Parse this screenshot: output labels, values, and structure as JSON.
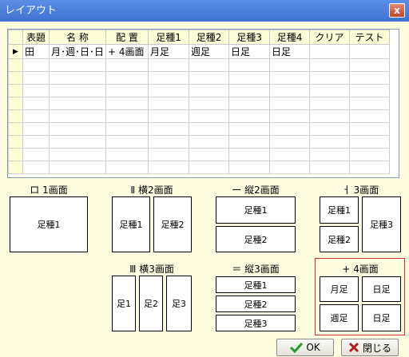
{
  "window": {
    "title": "レイアウト",
    "close_label": "x"
  },
  "grid": {
    "columns": [
      "表題",
      "名 称",
      "配 置",
      "足種1",
      "足種2",
      "足種3",
      "足種4",
      "クリア",
      "テスト"
    ],
    "rows": [
      {
        "indicator": "▶",
        "cells": [
          "田",
          "月･週･日･日",
          "+ 4画面",
          "月足",
          "週足",
          "日足",
          "日足",
          "",
          ""
        ]
      },
      {
        "indicator": "",
        "cells": [
          "",
          "",
          "",
          "",
          "",
          "",
          "",
          "",
          ""
        ]
      },
      {
        "indicator": "",
        "cells": [
          "",
          "",
          "",
          "",
          "",
          "",
          "",
          "",
          ""
        ]
      },
      {
        "indicator": "",
        "cells": [
          "",
          "",
          "",
          "",
          "",
          "",
          "",
          "",
          ""
        ]
      },
      {
        "indicator": "",
        "cells": [
          "",
          "",
          "",
          "",
          "",
          "",
          "",
          "",
          ""
        ]
      },
      {
        "indicator": "",
        "cells": [
          "",
          "",
          "",
          "",
          "",
          "",
          "",
          "",
          ""
        ]
      },
      {
        "indicator": "",
        "cells": [
          "",
          "",
          "",
          "",
          "",
          "",
          "",
          "",
          ""
        ]
      },
      {
        "indicator": "",
        "cells": [
          "",
          "",
          "",
          "",
          "",
          "",
          "",
          "",
          ""
        ]
      },
      {
        "indicator": "",
        "cells": [
          "",
          "",
          "",
          "",
          "",
          "",
          "",
          "",
          ""
        ]
      },
      {
        "indicator": "",
        "cells": [
          "",
          "",
          "",
          "",
          "",
          "",
          "",
          "",
          ""
        ]
      }
    ]
  },
  "layouts": {
    "one": {
      "label": "ロ 1画面",
      "panes": [
        "足種1"
      ]
    },
    "horiz2": {
      "label": "Ⅱ 横2画面",
      "panes": [
        "足種1",
        "足種2"
      ]
    },
    "vert2": {
      "label": "ー 縦2画面",
      "panes": [
        "足種1",
        "足種2"
      ]
    },
    "three": {
      "label": "ㅓ 3画面",
      "panes": [
        "足種1",
        "足種2",
        "足種3"
      ]
    },
    "horiz3": {
      "label": "Ⅲ 横3画面",
      "panes": [
        "足1",
        "足2",
        "足3"
      ]
    },
    "vert3": {
      "label": "＝ 縦3画面",
      "panes": [
        "足種1",
        "足種2",
        "足種3"
      ]
    },
    "four": {
      "label": "+ 4画面",
      "panes": [
        "月足",
        "日足",
        "週足",
        "日足"
      ]
    }
  },
  "buttons": {
    "ok": "OK",
    "close": "閉じる"
  },
  "colors": {
    "selected_border": "#d03030",
    "ok_icon": "#2a9a2a",
    "close_icon": "#b02020"
  }
}
